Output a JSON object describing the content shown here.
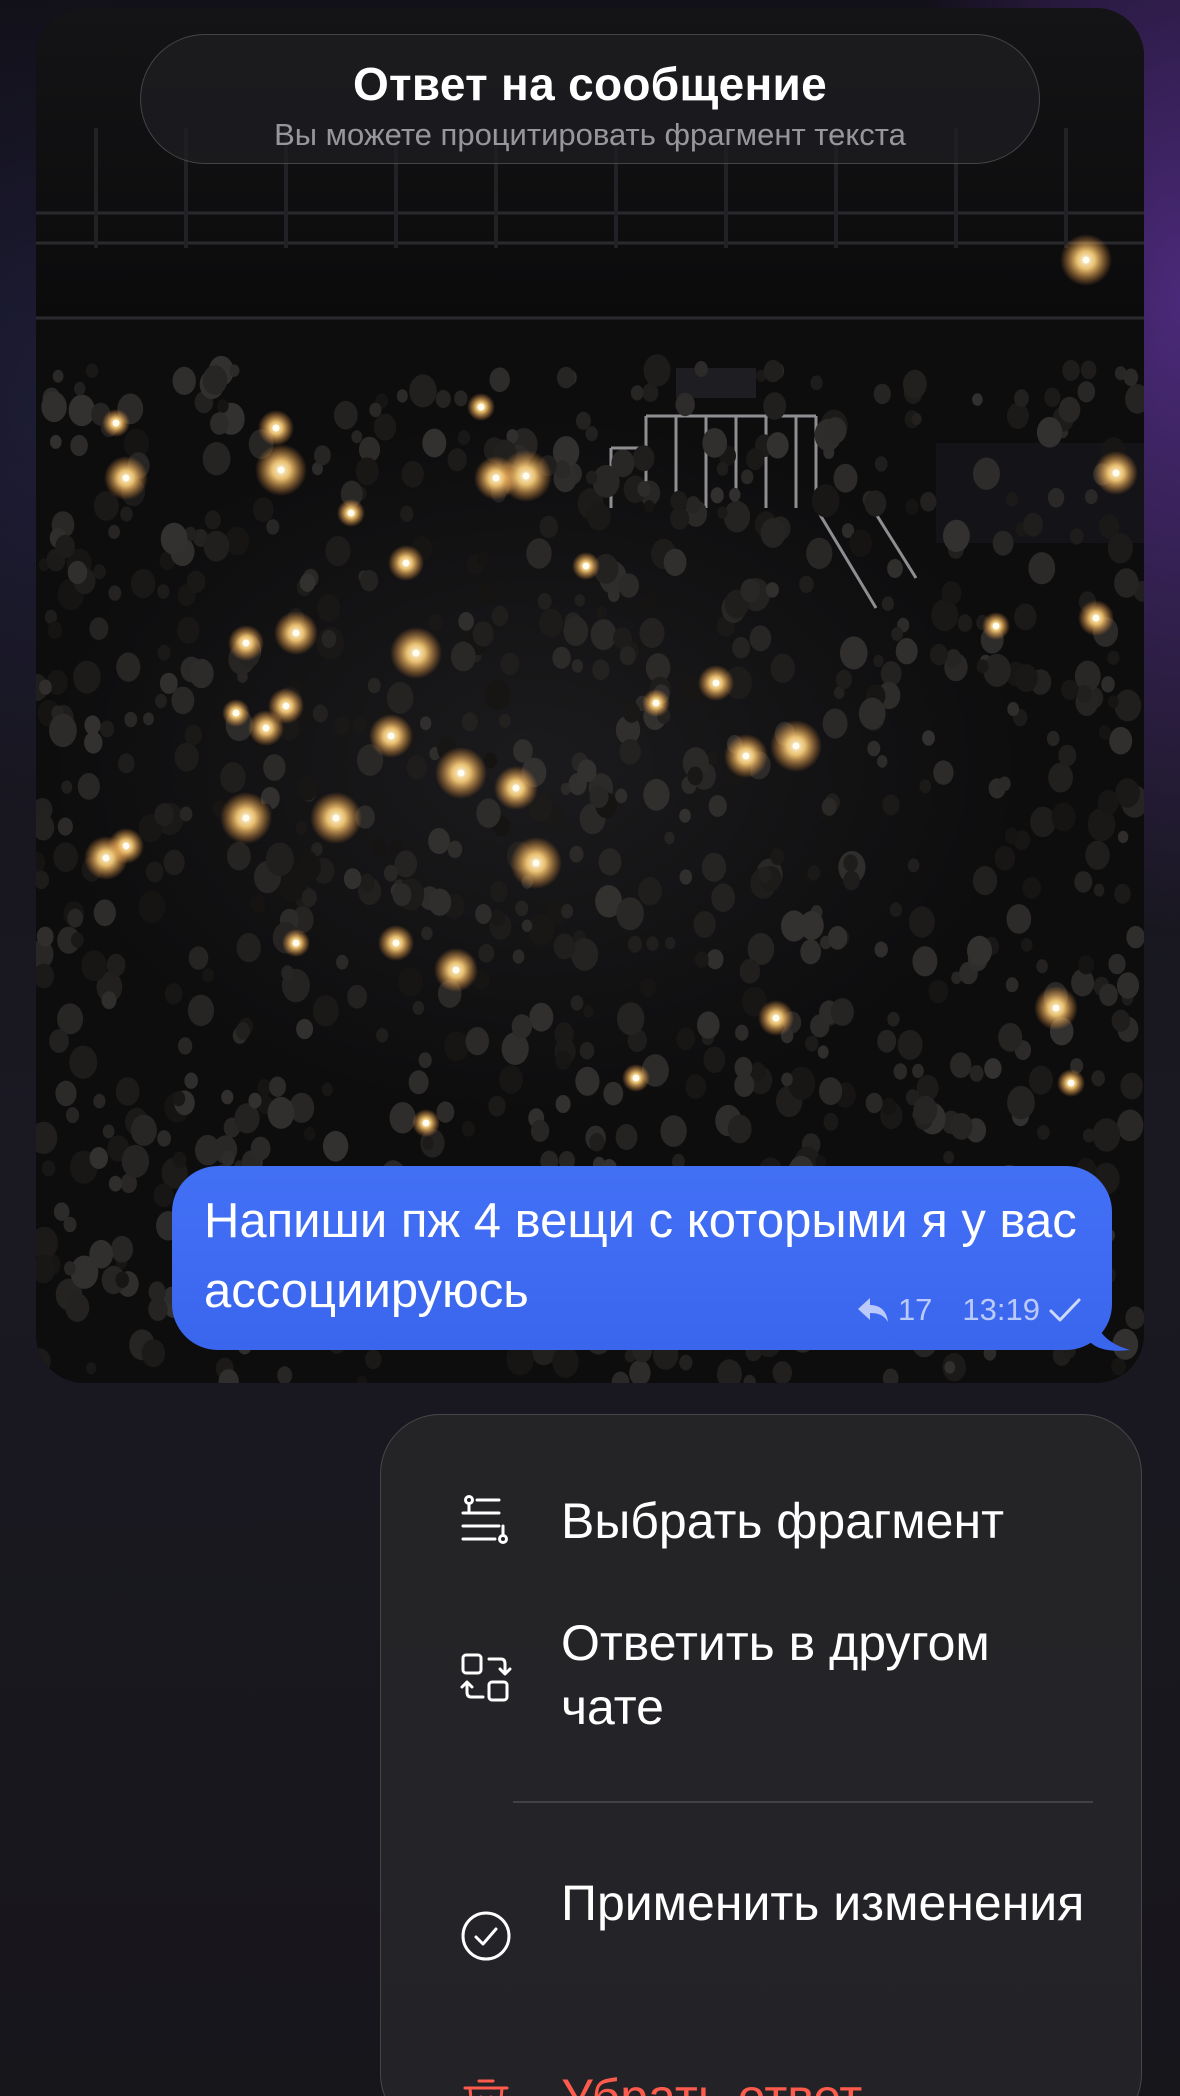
{
  "header": {
    "title": "Ответ на сообщение",
    "subtitle": "Вы можете процитировать фрагмент текста"
  },
  "message": {
    "text": "Напиши пж 4 вещи с которыми я у вас ассоциируюсь",
    "reply_count": "17",
    "time": "13:19",
    "status_icon": "check-icon",
    "bubble_color": "#3d6df3"
  },
  "menu": {
    "items": [
      {
        "icon": "select-fragment-icon",
        "label": "Выбрать фрагмент"
      },
      {
        "icon": "reply-other-chat-icon",
        "label": "Ответить в другом чате"
      },
      {
        "icon": "check-circle-icon",
        "label": "Применить изменения"
      },
      {
        "icon": "trash-icon",
        "label": "Убрать ответ",
        "color": "#ff5b4d"
      }
    ]
  }
}
